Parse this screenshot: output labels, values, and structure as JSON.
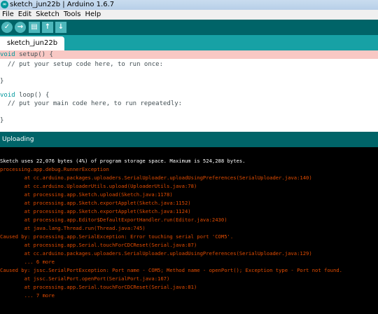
{
  "window": {
    "title": "sketch_jun22b | Arduino 1.6.7",
    "app_icon": "arduino-icon"
  },
  "menu": [
    "File",
    "Edit",
    "Sketch",
    "Tools",
    "Help"
  ],
  "toolbar": {
    "verify": "✓",
    "upload": "→",
    "new": "▤",
    "open": "↑",
    "save": "↓"
  },
  "tab": {
    "label": "sketch_jun22b"
  },
  "editor": {
    "line1_kw": "void",
    "line1_rest": " setup() {",
    "line2": "  // put your setup code here, to run once:",
    "line3": "",
    "line4": "}",
    "line5": "",
    "line6_kw": "void",
    "line6_rest": " loop() {",
    "line7": "  // put your main code here, to run repeatedly:",
    "line8": "",
    "line9": "}"
  },
  "status": {
    "text": "Uploading"
  },
  "console": [
    "Sketch uses 22,076 bytes (4%) of program storage space. Maximum is 524,288 bytes.",
    "processing.app.debug.RunnerException",
    "        at cc.arduino.packages.uploaders.SerialUploader.uploadUsingPreferences(SerialUploader.java:140)",
    "        at cc.arduino.UploaderUtils.upload(UploaderUtils.java:78)",
    "        at processing.app.Sketch.upload(Sketch.java:1178)",
    "        at processing.app.Sketch.exportApplet(Sketch.java:1152)",
    "        at processing.app.Sketch.exportApplet(Sketch.java:1124)",
    "        at processing.app.Editor$DefaultExportHandler.run(Editor.java:2430)",
    "        at java.lang.Thread.run(Thread.java:745)",
    "Caused by: processing.app.SerialException: Error touching serial port 'COM5'.",
    "        at processing.app.Serial.touchForCDCReset(Serial.java:87)",
    "        at cc.arduino.packages.uploaders.SerialUploader.uploadUsingPreferences(SerialUploader.java:129)",
    "        ... 6 more",
    "Caused by: jssc.SerialPortException: Port name - COM5; Method name - openPort(); Exception type - Port not found.",
    "        at jssc.SerialPort.openPort(SerialPort.java:167)",
    "        at processing.app.Serial.touchForCDCReset(Serial.java:81)",
    "        ... 7 more"
  ],
  "colors": {
    "toolbar_bg": "#006468",
    "tab_bg": "#17a1a5",
    "button_bg": "#4db7bb",
    "highlight": "#f8c8c4",
    "keyword": "#00979c",
    "error_text": "#e34c00"
  }
}
